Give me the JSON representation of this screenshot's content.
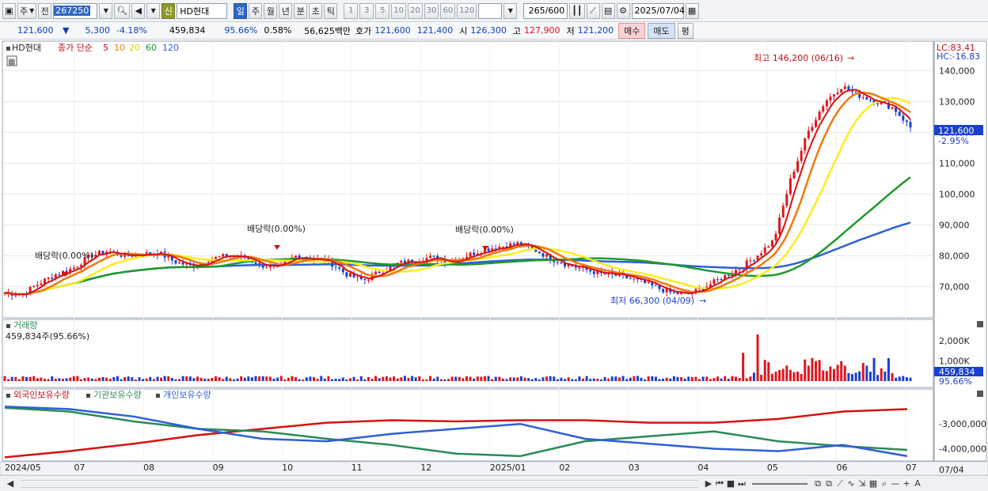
{
  "toolbar": {
    "market_label": "주",
    "prev_label": "전",
    "code": "267250",
    "name": "HD현대",
    "new_badge": "신",
    "periods": [
      "일",
      "주",
      "월",
      "년",
      "분",
      "초",
      "틱"
    ],
    "intervals": [
      "1",
      "3",
      "5",
      "10",
      "20",
      "30",
      "60",
      "120"
    ],
    "count_value": "265",
    "count_total": "/600",
    "date": "2025/07/04"
  },
  "quote": {
    "price": "121,600",
    "arrow": "▼",
    "change": "5,300",
    "pct": "-4.18%",
    "volume": "459,834",
    "vol_ratio": "95.66%",
    "turnover": "0.58%",
    "amount": "56,625백만",
    "bid_label": "호가",
    "bid": "121,600",
    "ask": "121,400",
    "open_label": "시",
    "open": "126,300",
    "high_label": "고",
    "high": "127,900",
    "low_label": "저",
    "low": "121,200",
    "buy_label": "매수",
    "sell_label": "매도",
    "flat_label": "평"
  },
  "price_panel": {
    "symbol": "HD현대",
    "ma_label": "종가 단순",
    "ma_periods": [
      "5",
      "10",
      "20",
      "60",
      "120"
    ],
    "lc": "LC:83.41",
    "hc": "HC:-16.83",
    "last_price": "121,600",
    "last_pct": "-2.95%",
    "y_ticks": [
      "140,000",
      "130,000",
      "120,000",
      "110,000",
      "100,000",
      "90,000",
      "80,000",
      "70,000"
    ],
    "max_label": "최고 146,200 (06/16)",
    "min_label": "최저 66,300 (04/09)",
    "dividend_labels": [
      "배당락(0.00%)",
      "배당락(0.00%)",
      "배당락(0.00%)"
    ]
  },
  "volume_panel": {
    "title": "거래량",
    "info": "459,834주(95.66%)",
    "y_ticks": [
      "2,000K",
      "1,000K"
    ],
    "last": "459,834",
    "last_pct": "95.66%"
  },
  "holding_panel": {
    "legend": [
      "외국인보유수량",
      "기관보유수량",
      "개인보유수량"
    ],
    "y_ticks": [
      "-3,000,000",
      "-4,000,000"
    ]
  },
  "x_axis": {
    "labels": [
      "2024/05",
      "07",
      "08",
      "09",
      "10",
      "11",
      "12",
      "2025/01",
      "02",
      "03",
      "04",
      "05",
      "06",
      "07"
    ],
    "right_label": "07/04"
  },
  "chart_data": {
    "type": "candlestick",
    "x": [
      "2024/05",
      "07",
      "08",
      "09",
      "10",
      "11",
      "12",
      "2025/01",
      "02",
      "03",
      "04",
      "05",
      "06",
      "07"
    ],
    "close_path": [
      68000,
      67500,
      71000,
      74000,
      76000,
      80000,
      81500,
      80000,
      80500,
      81000,
      78000,
      76500,
      79000,
      80000,
      79500,
      77000,
      76000,
      80000,
      79000,
      78000,
      74000,
      72000,
      75000,
      77500,
      78500,
      79500,
      78000,
      80000,
      82000,
      83000,
      84000,
      82000,
      79000,
      77000,
      75500,
      74000,
      73500,
      72000,
      70000,
      68000,
      67500,
      70000,
      73000,
      76000,
      80000,
      85000,
      105000,
      120000,
      130000,
      135000,
      132000,
      130000,
      128000,
      121600
    ],
    "max": 146200,
    "min": 66300,
    "last": 121600,
    "ylim": [
      64000,
      146000
    ],
    "colors": {
      "up": "#e0161c",
      "down": "#1a3fd0",
      "ma5": "#d81010",
      "ma10": "#f0780c",
      "ma20": "#ffec1a",
      "ma60": "#1e9a2a",
      "ma120": "#2e5fd8",
      "foreign": "#d81010",
      "institution": "#2a8a55",
      "individual": "#2e5fd8"
    }
  }
}
